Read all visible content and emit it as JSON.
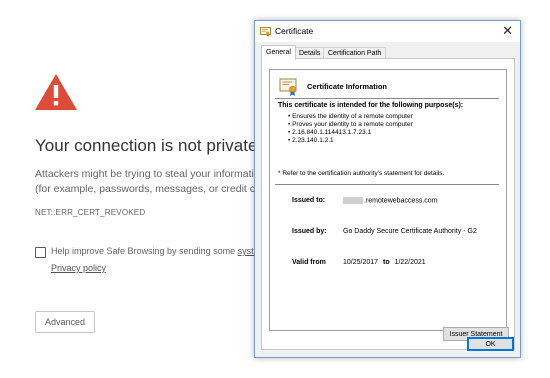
{
  "error_page": {
    "title": "Your connection is not private",
    "description_line1": "Attackers might be trying to steal your information",
    "description_line2": "(for example, passwords, messages, or credit cards",
    "error_code": "NET::ERR_CERT_REVOKED",
    "safe_browsing_text": "Help improve Safe Browsing by sending some ",
    "safe_browsing_link": "system",
    "privacy_link": "Privacy policy",
    "advanced_label": "Advanced",
    "icons": {
      "warning": "warning-triangle-icon"
    },
    "colors": {
      "warning_red": "#dd4b39"
    }
  },
  "dialog": {
    "title": "Certificate",
    "close_glyph": "✕",
    "tabs": [
      {
        "label": "General",
        "active": true
      },
      {
        "label": "Details",
        "active": false
      },
      {
        "label": "Certification Path",
        "active": false
      }
    ],
    "heading": "Certificate Information",
    "purposes_heading": "This certificate is intended for the following purpose(s):",
    "purposes": [
      "• Ensures the identity of a remote computer",
      "• Proves your identity to a remote computer",
      "• 2.16.840.1.114413.1.7.23.1",
      "• 2.23.140.1.2.1"
    ],
    "refer_note": "* Refer to the certification authority's statement for details.",
    "issued_to_label": "Issued to:",
    "issued_to_value": ".remotewebaccess.com",
    "issued_by_label": "Issued by:",
    "issued_by_value": "Go Daddy Secure Certificate Authority - G2",
    "valid_from_label": "Valid from",
    "valid_from_value": "10/25/2017",
    "valid_to_label": "to",
    "valid_to_value": "1/22/2021",
    "issuer_statement_label": "Issuer Statement",
    "ok_label": "OK",
    "icons": {
      "title": "certificate-icon",
      "info": "certificate-badge-icon"
    }
  }
}
